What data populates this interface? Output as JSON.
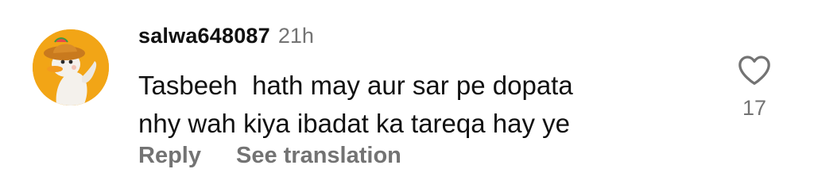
{
  "comment": {
    "avatar_icon": "cartoon-duck-avatar-icon",
    "username": "salwa648087",
    "timestamp": "21h",
    "text_lines": [
      "Tasbeeh  hath may aur sar pe dopata",
      "nhy wah kiya ibadat ka tareqa hay ye"
    ],
    "actions": {
      "reply_label": "Reply",
      "translate_label": "See translation"
    },
    "like": {
      "icon": "heart-outline-icon",
      "count": "17"
    }
  },
  "colors": {
    "text_primary": "#111111",
    "text_secondary": "#737373",
    "avatar_bg": "#f2a516"
  }
}
